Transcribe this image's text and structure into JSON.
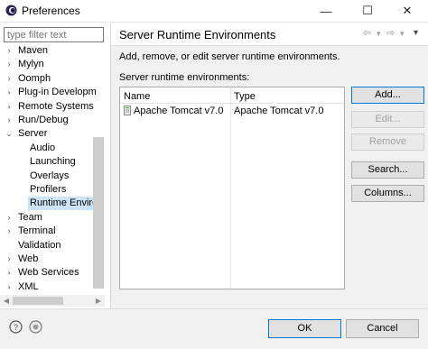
{
  "window": {
    "title": "Preferences",
    "minimize_glyph": "—",
    "maximize_glyph": "☐",
    "close_glyph": "✕"
  },
  "filter": {
    "placeholder": "type filter text"
  },
  "tree": {
    "items": [
      {
        "label": "Maven",
        "arrow": "›",
        "level": 0
      },
      {
        "label": "Mylyn",
        "arrow": "›",
        "level": 0
      },
      {
        "label": "Oomph",
        "arrow": "›",
        "level": 0
      },
      {
        "label": "Plug-in Developm",
        "arrow": "›",
        "level": 0
      },
      {
        "label": "Remote Systems",
        "arrow": "›",
        "level": 0
      },
      {
        "label": "Run/Debug",
        "arrow": "›",
        "level": 0
      },
      {
        "label": "Server",
        "arrow": "⌄",
        "level": 0
      },
      {
        "label": "Audio",
        "arrow": "",
        "level": 1
      },
      {
        "label": "Launching",
        "arrow": "",
        "level": 1
      },
      {
        "label": "Overlays",
        "arrow": "",
        "level": 1
      },
      {
        "label": "Profilers",
        "arrow": "",
        "level": 1
      },
      {
        "label": "Runtime Enviror",
        "arrow": "",
        "level": 1,
        "selected": true
      },
      {
        "label": "Team",
        "arrow": "›",
        "level": 0
      },
      {
        "label": "Terminal",
        "arrow": "›",
        "level": 0
      },
      {
        "label": "Validation",
        "arrow": "",
        "level": 0
      },
      {
        "label": "Web",
        "arrow": "›",
        "level": 0
      },
      {
        "label": "Web Services",
        "arrow": "›",
        "level": 0
      },
      {
        "label": "XML",
        "arrow": "›",
        "level": 0
      }
    ]
  },
  "page": {
    "title": "Server Runtime Environments",
    "description": "Add, remove, or edit server runtime environments.",
    "list_label": "Server runtime environments:",
    "nav": {
      "back": "⇦",
      "back_menu": "▾",
      "forward": "⇨",
      "forward_menu": "▾",
      "view_menu": "▾"
    }
  },
  "table": {
    "columns": [
      "Name",
      "Type"
    ],
    "rows": [
      {
        "name": "Apache Tomcat v7.0",
        "type": "Apache Tomcat v7.0"
      }
    ]
  },
  "buttons": {
    "add": "Add...",
    "edit": "Edit...",
    "remove": "Remove",
    "search": "Search...",
    "columns": "Columns..."
  },
  "dialog": {
    "ok": "OK",
    "cancel": "Cancel",
    "help_glyph": "?"
  },
  "colors": {
    "selection": "#cce4f7",
    "default_button_border": "#0078d7",
    "eclipse_purple": "#2c2255"
  }
}
